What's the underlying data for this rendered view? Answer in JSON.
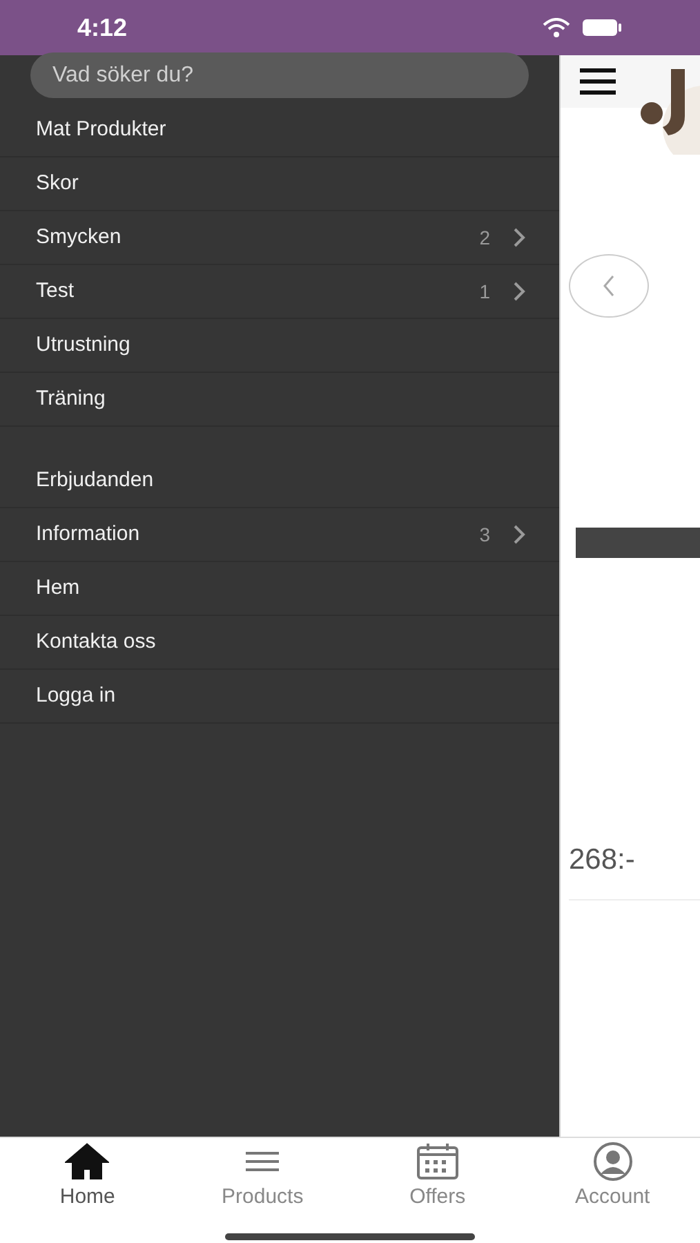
{
  "status_bar": {
    "time": "4:12"
  },
  "search": {
    "placeholder": "Vad söker du?"
  },
  "menu_sections": [
    {
      "items": [
        {
          "label": "Mat Produkter"
        },
        {
          "label": "Skor"
        },
        {
          "label": "Smycken",
          "count": "2"
        },
        {
          "label": "Test",
          "count": "1"
        },
        {
          "label": "Utrustning"
        },
        {
          "label": "Träning"
        }
      ]
    },
    {
      "items": [
        {
          "label": "Erbjudanden"
        },
        {
          "label": "Information",
          "count": "3"
        },
        {
          "label": "Hem"
        },
        {
          "label": "Kontakta oss"
        },
        {
          "label": "Logga in"
        }
      ]
    }
  ],
  "content": {
    "price": "268:-"
  },
  "tabs": [
    {
      "label": "Home",
      "kind": "home",
      "selected": true
    },
    {
      "label": "Products",
      "kind": "products",
      "selected": false
    },
    {
      "label": "Offers",
      "kind": "offers",
      "selected": false
    },
    {
      "label": "Account",
      "kind": "account",
      "selected": false
    }
  ]
}
